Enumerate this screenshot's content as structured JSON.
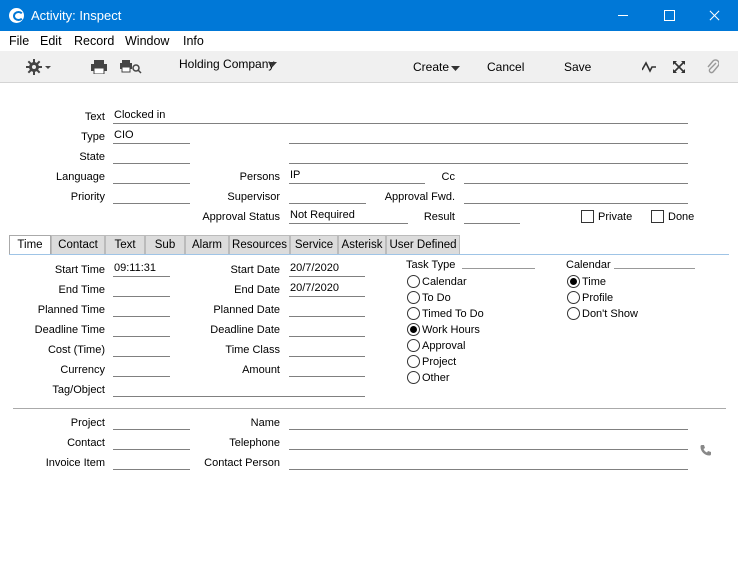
{
  "window": {
    "title": "Activity: Inspect"
  },
  "menu": [
    "File",
    "Edit",
    "Record",
    "Window",
    "Info"
  ],
  "toolbar": {
    "company": "Holding Company",
    "create": "Create",
    "cancel": "Cancel",
    "save": "Save"
  },
  "header": {
    "text_label": "Text",
    "text_value": "Clocked in",
    "type_label": "Type",
    "type_value": "CIO",
    "state_label": "State",
    "state_value": "",
    "language_label": "Language",
    "language_value": "",
    "priority_label": "Priority",
    "priority_value": "",
    "persons_label": "Persons",
    "persons_value": "IP",
    "cc_label": "Cc",
    "cc_value": "",
    "supervisor_label": "Supervisor",
    "supervisor_value": "",
    "approval_fwd_label": "Approval Fwd.",
    "approval_fwd_value": "",
    "approval_status_label": "Approval Status",
    "approval_status_value": "Not Required",
    "result_label": "Result",
    "result_value": "",
    "private_label": "Private",
    "done_label": "Done"
  },
  "tabs": [
    {
      "label": "Time",
      "active": true
    },
    {
      "label": "Contact"
    },
    {
      "label": "Text"
    },
    {
      "label": "Sub"
    },
    {
      "label": "Alarm"
    },
    {
      "label": "Resources"
    },
    {
      "label": "Service"
    },
    {
      "label": "Asterisk"
    },
    {
      "label": "User Defined"
    }
  ],
  "time_tab": {
    "start_time_label": "Start Time",
    "start_time_value": "09:11:31",
    "end_time_label": "End Time",
    "end_time_value": "",
    "planned_time_label": "Planned Time",
    "planned_time_value": "",
    "deadline_time_label": "Deadline Time",
    "deadline_time_value": "",
    "cost_time_label": "Cost (Time)",
    "cost_time_value": "",
    "currency_label": "Currency",
    "currency_value": "",
    "tag_object_label": "Tag/Object",
    "tag_object_value": "",
    "start_date_label": "Start Date",
    "start_date_value": "20/7/2020",
    "end_date_label": "End Date",
    "end_date_value": "20/7/2020",
    "planned_date_label": "Planned Date",
    "planned_date_value": "",
    "deadline_date_label": "Deadline Date",
    "deadline_date_value": "",
    "time_class_label": "Time Class",
    "time_class_value": "",
    "amount_label": "Amount",
    "amount_value": ""
  },
  "task_type": {
    "title": "Task Type",
    "options": [
      "Calendar",
      "To Do",
      "Timed To Do",
      "Work Hours",
      "Approval",
      "Project",
      "Other"
    ],
    "selected": "Work Hours"
  },
  "calendar": {
    "title": "Calendar",
    "options": [
      "Time",
      "Profile",
      "Don't Show"
    ],
    "selected": "Time"
  },
  "footer": {
    "project_label": "Project",
    "project_value": "",
    "contact_label": "Contact",
    "contact_value": "",
    "invoice_item_label": "Invoice Item",
    "invoice_item_value": "",
    "name_label": "Name",
    "name_value": "",
    "telephone_label": "Telephone",
    "telephone_value": "",
    "contact_person_label": "Contact Person",
    "contact_person_value": ""
  },
  "icons": [
    "gear-icon",
    "print-icon",
    "print-search-icon",
    "activity-icon",
    "expand-icon",
    "paperclip-icon",
    "phone-icon"
  ]
}
